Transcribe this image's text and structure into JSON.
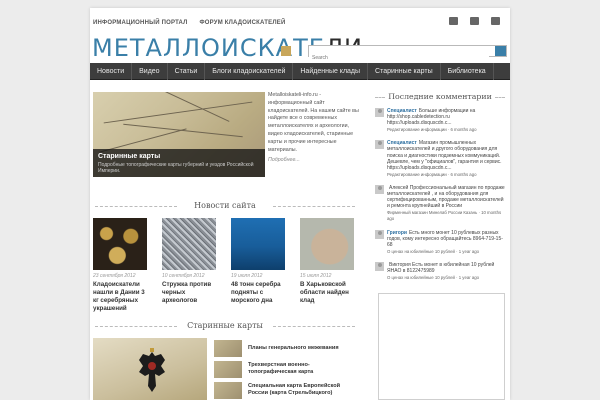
{
  "toplinks": [
    "ИНФОРМАЦИОННЫЙ ПОРТАЛ",
    "ФОРУМ КЛАДОИСКАТЕЛЕЙ"
  ],
  "logo": {
    "main": "МЕТАЛЛОИСКАТЕ",
    "tail": "ЛИ"
  },
  "search": {
    "placeholder": "Search"
  },
  "nav": [
    "Новости",
    "Видео",
    "Статьи",
    "Блоги кладоискателей",
    "Найденные клады",
    "Старинные карты",
    "Библиотека"
  ],
  "feature": {
    "title": "Старинные карты",
    "description": "Подробные топографические карты губерний и уездов Российской Империи."
  },
  "about": {
    "text": "Metalloiskateli-info.ru - информационный сайт кладоискателей. На нашем сайте вы найдете все о современных металлоискателях и археологии, видео кладоискателей, старинные карты и прочие интересные материалы.",
    "more": "Подробнее..."
  },
  "news_section": {
    "title": "Новости сайта"
  },
  "news": [
    {
      "date": "23 сентября 2012",
      "title": "Кладоискатели нашли в Дании 3 кг серебряных украшений",
      "thumb": "thumb-jewelry"
    },
    {
      "date": "10 сентября 2012",
      "title": "Стружка против черных археологов",
      "thumb": "thumb-shavings"
    },
    {
      "date": "19 июля 2012",
      "title": "48 тонн серебра подняты с морского дна",
      "thumb": "thumb-underwater"
    },
    {
      "date": "15 июля 2012",
      "title": "В Харьковской области найден клад",
      "thumb": "thumb-hand-coins"
    }
  ],
  "maps_section": {
    "title": "Старинные карты"
  },
  "maps": [
    "Планы генерального межевания",
    "Трехверстная военно-топографическая карта",
    "Специальная карта Европейской России (карта Стрельбицкого)"
  ],
  "sidebar": {
    "title": "Последние комментарии",
    "comments": [
      {
        "author": "Специалист",
        "text": "Больше информации на http://shop.cabledetection.ru https://uploads.disquscdn.c...",
        "meta": "Редактирование информации · 6 months ago"
      },
      {
        "author": "Специалист",
        "text": "Магазин промышленных металлоискателей и другого оборудования для поиска и диагностики подземных коммуникаций. Дешевле, чем у \"официалов\", гарантия и сервис. https://uploads.disquscdn.c...",
        "meta": "Редактирование информации · 6 months ago"
      },
      {
        "author": "",
        "text": "Алексей Профессиональный магазин по продаже металлоискателей , и на оборудования для сертифицированным, продаже металлоискателей и ремонта крупнейший в России",
        "meta": "Фирменный магазин Минелаб России Казань · 10 months ago"
      },
      {
        "author": "Григори",
        "text": "Есть много монет 10 рублевых разных годов, кому интересно обращайтесь 8964-719-15-68",
        "meta": "О ценах на юбилейные 10 рублей · 1 year ago"
      },
      {
        "author": "",
        "text": "Виктория Есть монет в юбилейная 10 рублей ЯНАО в 8122475989",
        "meta": "О ценах на юбилейные 10 рублей · 1 year ago"
      }
    ]
  },
  "colors": {
    "accent": "#3a7fa8",
    "nav_bg": "#3d3d3d",
    "author": "#2d6fa0"
  },
  "icons": [
    "rss-icon",
    "mail-icon",
    "user-icon"
  ]
}
